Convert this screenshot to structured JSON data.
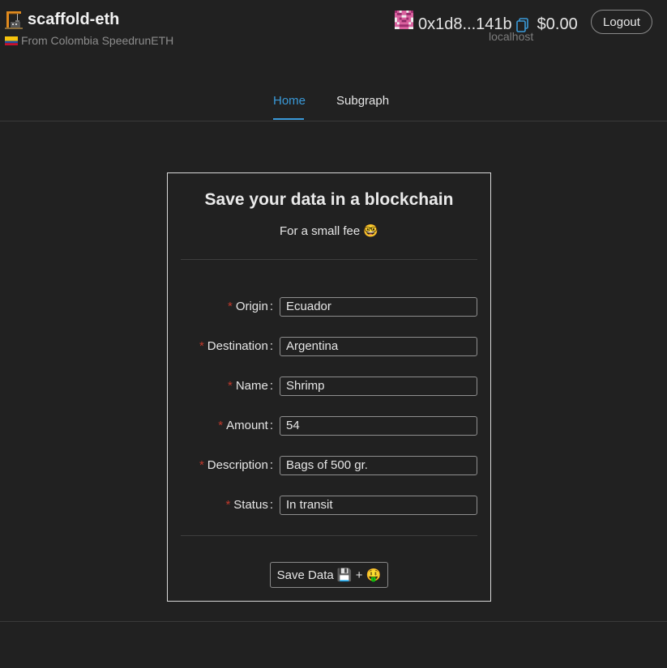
{
  "header": {
    "title": "scaffold-eth",
    "subtitle": "From Colombia SpeedrunETH",
    "address": "0x1d8...141b",
    "balance": "$0.00",
    "network": "localhost",
    "logout_label": "Logout"
  },
  "nav": {
    "tabs": [
      {
        "label": "Home",
        "active": true
      },
      {
        "label": "Subgraph",
        "active": false
      }
    ]
  },
  "form": {
    "title": "Save your data in a blockchain",
    "subtitle": "For a small fee 🤓",
    "fields": [
      {
        "label": "Origin",
        "value": "Ecuador"
      },
      {
        "label": "Destination",
        "value": "Argentina"
      },
      {
        "label": "Name",
        "value": "Shrimp"
      },
      {
        "label": "Amount",
        "value": "54"
      },
      {
        "label": "Description",
        "value": "Bags of 500 gr."
      },
      {
        "label": "Status",
        "value": "In transit"
      }
    ],
    "submit_label": "Save Data 💾 + 🤑"
  },
  "colors": {
    "accent": "#3a9ad9",
    "background": "#212121",
    "required": "#c0392b"
  }
}
